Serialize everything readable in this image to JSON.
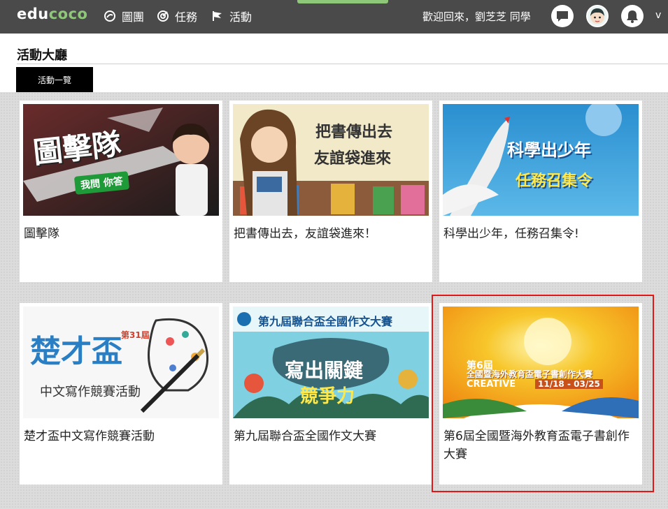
{
  "header": {
    "logo_part1": "edu",
    "logo_part2": "coco",
    "nav": [
      {
        "label": "圖團",
        "icon": "group-icon"
      },
      {
        "label": "任務",
        "icon": "target-icon"
      },
      {
        "label": "活動",
        "icon": "flag-icon"
      }
    ],
    "welcome": "歡迎回來，劉芝芝 同學",
    "user_menu_caret": "v"
  },
  "page": {
    "title": "活動大廳",
    "tab_label": "活動一覽"
  },
  "cards": [
    {
      "label": "圖擊隊",
      "thumb_title": "圖擊隊",
      "thumb_badge": "我問 你答"
    },
    {
      "label": "把書傳出去，友誼袋進來！",
      "thumb_line1": "把書傳出去",
      "thumb_line2": "友誼袋進來"
    },
    {
      "label": "科學出少年，任務召集令!",
      "thumb_line1": "科學出少年",
      "thumb_line2": "任務召集令"
    },
    {
      "label": "楚才盃中文寫作競賽活動",
      "thumb_title": "楚才盃",
      "thumb_sub": "中文寫作競賽活動",
      "thumb_badge": "第31屆"
    },
    {
      "label": "第九屆聯合盃全國作文大賽",
      "thumb_line1": "第九屆聯合盃全國作文大賽",
      "thumb_line2": "寫出關鍵",
      "thumb_line3": "競爭力"
    },
    {
      "label": "第6屆全國暨海外教育盃電子書創作大賽",
      "thumb_line1": "第6屆",
      "thumb_line2": "全國暨海外教育盃電子書創作大賽",
      "thumb_line3": "CREATIVE",
      "thumb_line4": "11/18 - 03/25"
    }
  ]
}
